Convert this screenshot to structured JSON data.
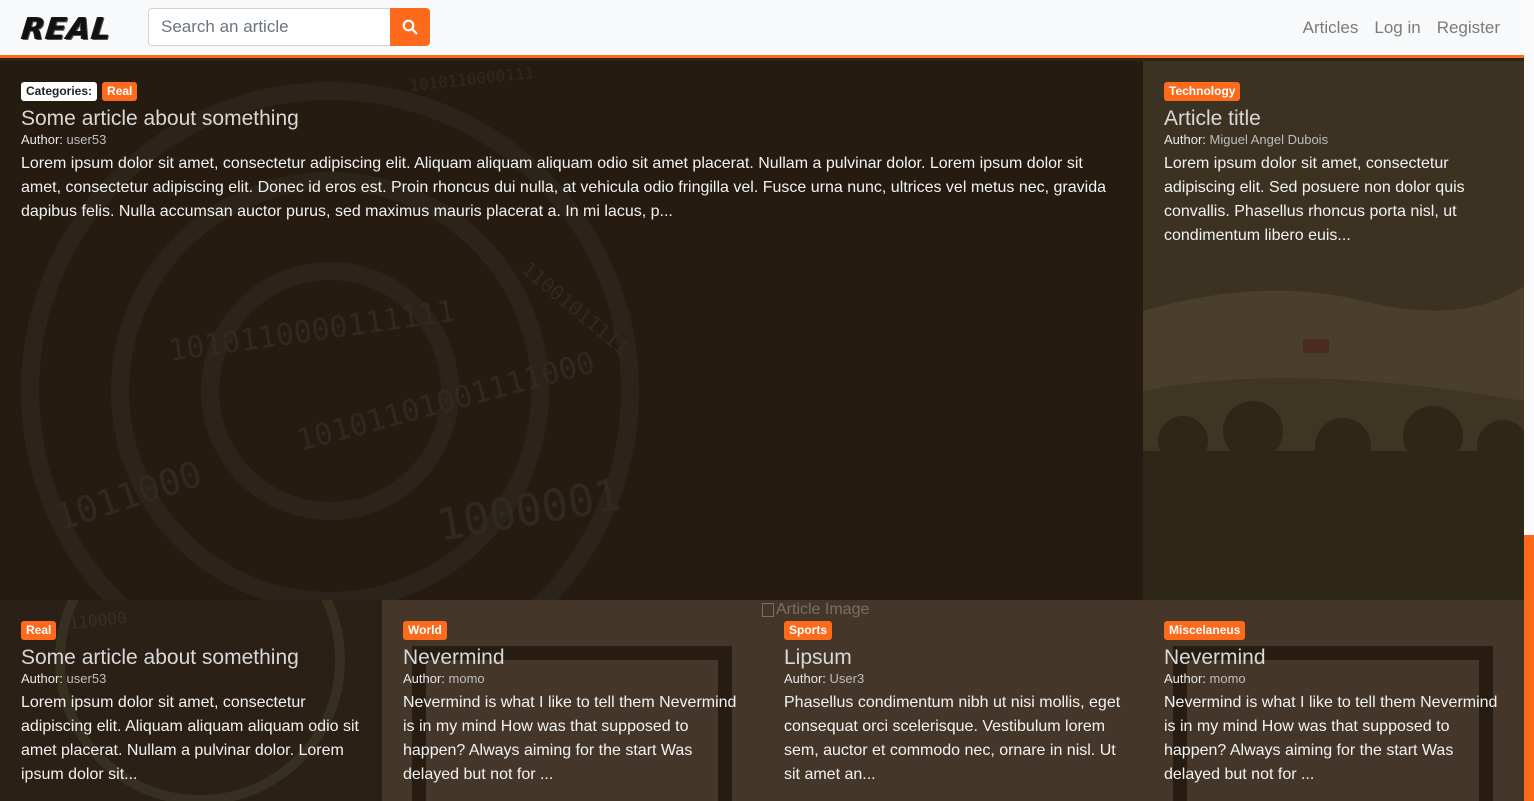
{
  "nav": {
    "logo": "REAL",
    "search_placeholder": "Search an article",
    "links": [
      "Articles",
      "Log in",
      "Register"
    ]
  },
  "broken_image_alt": "Article Image",
  "cards": [
    {
      "label": "Categories:",
      "categories": [
        "Real"
      ],
      "title": "Some article about something",
      "author_label": "Author:",
      "author": "user53",
      "excerpt": "Lorem ipsum dolor sit amet, consectetur adipiscing elit. Aliquam aliquam aliquam odio sit amet placerat. Nullam a pulvinar dolor. Lorem ipsum dolor sit amet, consectetur adipiscing elit. Donec id eros est. Proin rhoncus dui nulla, at vehicula odio fringilla vel. Fusce urna nunc, ultrices vel metus nec, gravida dapibus felis. Nulla accumsan auctor purus, sed maximus mauris placerat a. In mi lacus, p..."
    },
    {
      "categories": [
        "Technology"
      ],
      "title": "Article title",
      "author_label": "Author:",
      "author": "Miguel Angel Dubois",
      "excerpt": "Lorem ipsum dolor sit amet, consectetur adipiscing elit. Sed posuere non dolor quis convallis. Phasellus rhoncus porta nisl, ut condimentum libero euis..."
    },
    {
      "categories": [
        "Real"
      ],
      "title": "Some article about something",
      "author_label": "Author:",
      "author": "user53",
      "excerpt": "Lorem ipsum dolor sit amet, consectetur adipiscing elit. Aliquam aliquam aliquam odio sit amet placerat. Nullam a pulvinar dolor. Lorem ipsum dolor sit..."
    },
    {
      "categories": [
        "World"
      ],
      "title": "Nevermind",
      "author_label": "Author:",
      "author": "momo",
      "excerpt": "Nevermind is what I like to tell them Nevermind is in my mind How was that supposed to happen? Always aiming for the start Was delayed but not for ..."
    },
    {
      "categories": [
        "Sports"
      ],
      "title": "Lipsum",
      "author_label": "Author:",
      "author": "User3",
      "excerpt": "Phasellus condimentum nibh ut nisi mollis, eget consequat orci scelerisque. Vestibulum lorem sem, auctor et commodo nec, ornare in nisl. Ut sit amet an..."
    },
    {
      "categories": [
        "Miscelaneus"
      ],
      "title": "Nevermind",
      "author_label": "Author:",
      "author": "momo",
      "excerpt": "Nevermind is what I like to tell them Nevermind is in my mind How was that supposed to happen? Always aiming for the start Was delayed but not for ..."
    }
  ],
  "colors": {
    "accent": "#fd6a1c",
    "navbar_bg": "#f8f9fa"
  }
}
